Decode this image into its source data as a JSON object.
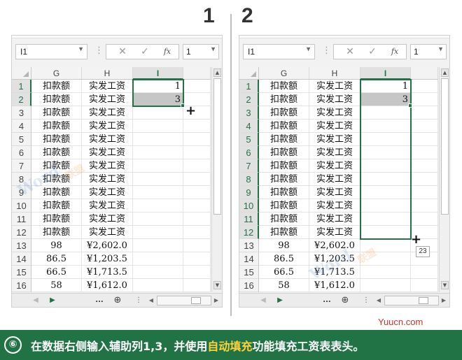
{
  "labels": {
    "left": "1",
    "right": "2"
  },
  "toolbar": {
    "name_box": "I1",
    "cancel_glyph": "✕",
    "enter_glyph": "✓",
    "fx_label": "fx",
    "value_preview": "1",
    "more_glyph": "⋮",
    "dropdown_glyph": "▼"
  },
  "sheet": {
    "columns": [
      "G",
      "H",
      "I"
    ],
    "rows": [
      {
        "n": "1",
        "g": "扣款额",
        "h": "实发工资",
        "i": "1"
      },
      {
        "n": "2",
        "g": "扣款额",
        "h": "实发工资",
        "i": "3"
      },
      {
        "n": "3",
        "g": "扣款额",
        "h": "实发工资",
        "i": ""
      },
      {
        "n": "4",
        "g": "扣款额",
        "h": "实发工资",
        "i": ""
      },
      {
        "n": "5",
        "g": "扣款额",
        "h": "实发工资",
        "i": ""
      },
      {
        "n": "6",
        "g": "扣款额",
        "h": "实发工资",
        "i": ""
      },
      {
        "n": "7",
        "g": "扣款额",
        "h": "实发工资",
        "i": ""
      },
      {
        "n": "8",
        "g": "扣款额",
        "h": "实发工资",
        "i": ""
      },
      {
        "n": "9",
        "g": "扣款额",
        "h": "实发工资",
        "i": ""
      },
      {
        "n": "10",
        "g": "扣款额",
        "h": "实发工资",
        "i": ""
      },
      {
        "n": "11",
        "g": "扣款额",
        "h": "实发工资",
        "i": ""
      },
      {
        "n": "12",
        "g": "扣款额",
        "h": "实发工资",
        "i": ""
      },
      {
        "n": "13",
        "g": "98",
        "h": "¥2,602.0",
        "i": ""
      },
      {
        "n": "14",
        "g": "86.5",
        "h": "¥1,203.5",
        "i": ""
      },
      {
        "n": "15",
        "g": "66.5",
        "h": "¥1,713.5",
        "i": ""
      },
      {
        "n": "16",
        "g": "58",
        "h": "¥1,612.0",
        "i": ""
      }
    ]
  },
  "tabbar": {
    "ellipsis": "...",
    "add_glyph": "⊕",
    "prev_glyph": "◀",
    "next_glyph": "▶",
    "more_glyph": "⋮"
  },
  "fill_tooltip": "23",
  "watermark": {
    "text": "Word",
    "sub": "联盟"
  },
  "site": "Yuucn.com",
  "caption": {
    "num": "⑥",
    "before": "在数据右侧输入辅助列1,3，并使用",
    "highlight": "自动填充",
    "after": "功能填充工资表表头。"
  },
  "colors": {
    "accent": "#217346",
    "highlight": "#ffd23c",
    "site": "#c0392b"
  }
}
